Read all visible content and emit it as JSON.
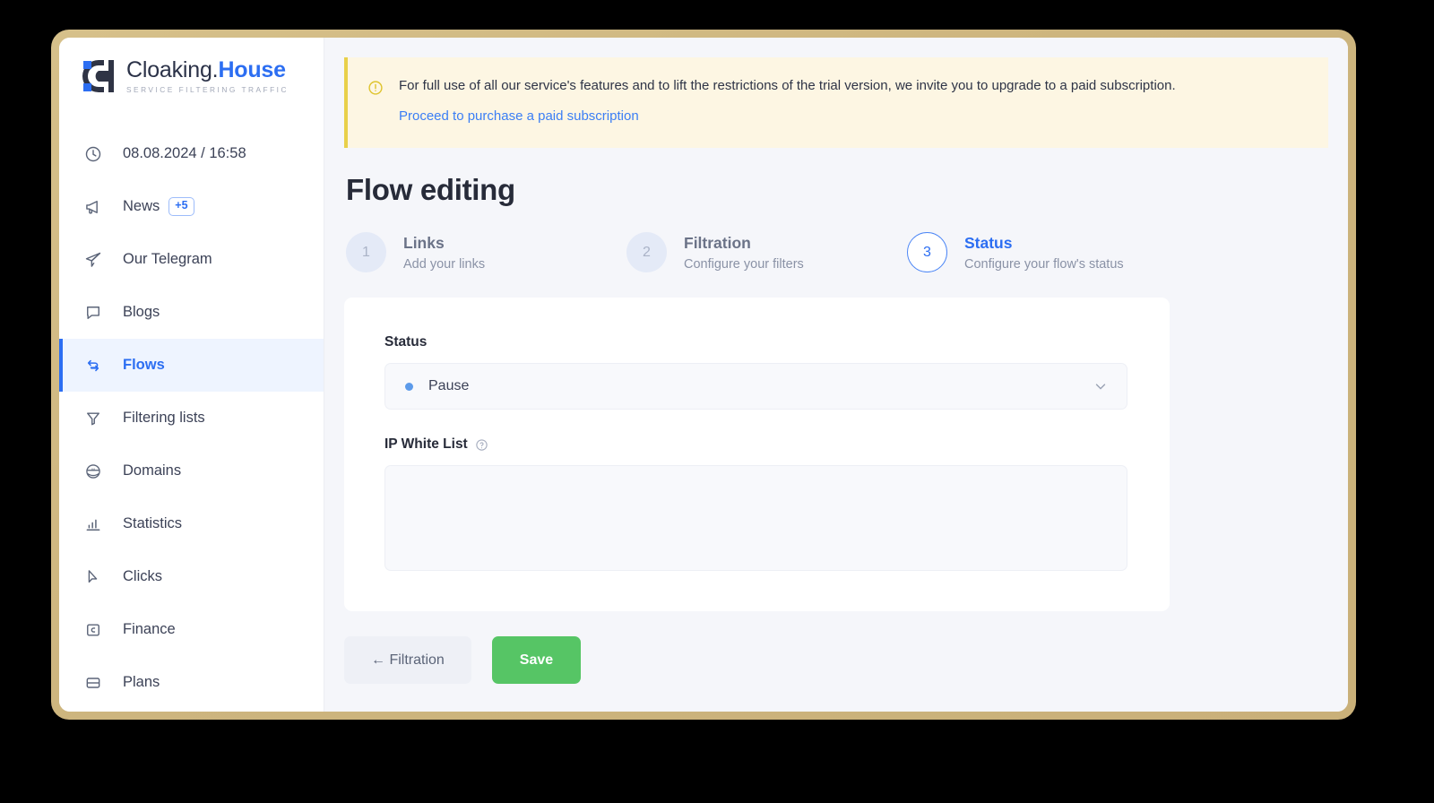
{
  "brand": {
    "name_plain": "Cloaking.",
    "name_accent": "House",
    "tagline": "SERVICE FILTERING TRAFFIC",
    "accent_color": "#2c6ef2"
  },
  "sidebar": {
    "datetime": "08.08.2024 / 16:58",
    "items": [
      {
        "label": "News",
        "icon": "megaphone-icon",
        "badge": "+5",
        "active": false
      },
      {
        "label": "Our Telegram",
        "icon": "telegram-send-icon",
        "active": false
      },
      {
        "label": "Blogs",
        "icon": "chat-bubble-icon",
        "active": false
      },
      {
        "label": "Flows",
        "icon": "refresh-arrows-icon",
        "active": true
      },
      {
        "label": "Filtering lists",
        "icon": "funnel-icon",
        "active": false
      },
      {
        "label": "Domains",
        "icon": "globe-icon",
        "active": false
      },
      {
        "label": "Statistics",
        "icon": "bar-chart-icon",
        "active": false
      },
      {
        "label": "Clicks",
        "icon": "cursor-arrow-icon",
        "active": false
      },
      {
        "label": "Finance",
        "icon": "wallet-icon",
        "active": false
      },
      {
        "label": "Plans",
        "icon": "card-rows-icon",
        "active": false
      }
    ]
  },
  "banner": {
    "icon": "warning-circle-icon",
    "message": "For full use of all our service's features and to lift the restrictions of the trial version, we invite you to upgrade to a paid subscription.",
    "link_label": "Proceed to purchase a paid subscription",
    "background_color": "#fdf6e3",
    "accent_color": "#e8d04a",
    "link_color": "#3b7ef5"
  },
  "page": {
    "title": "Flow editing"
  },
  "stepper": {
    "steps": [
      {
        "number": "1",
        "name": "Links",
        "desc": "Add your links",
        "state": "inactive"
      },
      {
        "number": "2",
        "name": "Filtration",
        "desc": "Configure your filters",
        "state": "inactive"
      },
      {
        "number": "3",
        "name": "Status",
        "desc": "Configure your flow's status",
        "state": "current"
      }
    ]
  },
  "form": {
    "status": {
      "label": "Status",
      "selected_value": "Pause",
      "dot_color": "#5d9bea",
      "chevron_icon": "chevron-down-icon"
    },
    "ip_white_list": {
      "label": "IP White List",
      "help_icon": "question-circle-icon",
      "value": "",
      "placeholder": ""
    }
  },
  "actions": {
    "back_label": "← Filtration",
    "save_label": "Save",
    "save_color": "#56c565"
  }
}
